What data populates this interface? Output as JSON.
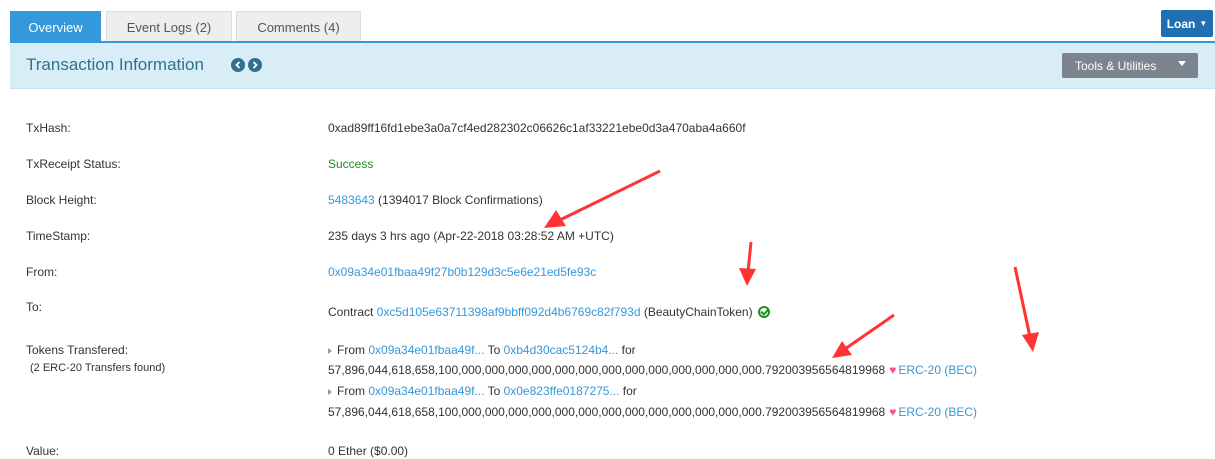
{
  "tabs": [
    {
      "label": "Overview",
      "active": true
    },
    {
      "label": "Event Logs (2)",
      "active": false
    },
    {
      "label": "Comments (4)",
      "active": false
    }
  ],
  "loan_button": "Loan",
  "panel": {
    "title": "Transaction Information",
    "tools_label": "Tools & Utilities"
  },
  "rows": {
    "txhash": {
      "label": "TxHash:",
      "value": "0xad89ff16fd1ebe3a0a7cf4ed282302c06626c1af33221ebe0d3a470aba4a660f"
    },
    "status": {
      "label": "TxReceipt Status:",
      "value": "Success"
    },
    "block": {
      "label": "Block Height:",
      "value": "5483643",
      "confirmations": " (1394017 Block Confirmations)"
    },
    "timestamp": {
      "label": "TimeStamp:",
      "value": "235 days 3 hrs ago (Apr-22-2018 03:28:52 AM +UTC)"
    },
    "from": {
      "label": "From:",
      "value": "0x09a34e01fbaa49f27b0b129d3c5e6e21ed5fe93c"
    },
    "to": {
      "label": "To:",
      "prefix": "Contract ",
      "address": "0xc5d105e63711398af9bbff092d4b6769c82f793d",
      "name": " (BeautyChainToken)"
    },
    "tokens": {
      "label": "Tokens Transfered:",
      "sublabel": "(2 ERC-20 Transfers found)",
      "transfers": [
        {
          "from_word": "From ",
          "from": "0x09a34e01fbaa49f...",
          "to_word": " To ",
          "to": "0xb4d30cac5124b4...",
          "for_word": " for",
          "amount": "57,896,044,618,658,100,000,000,000,000,000,000,000,000,000,000,000,000,000.792003956564819968",
          "token": "ERC-20 (BEC)"
        },
        {
          "from_word": "From ",
          "from": "0x09a34e01fbaa49f...",
          "to_word": " To ",
          "to": "0x0e823ffe0187275...",
          "for_word": " for",
          "amount": "57,896,044,618,658,100,000,000,000,000,000,000,000,000,000,000,000,000,000.792003956564819968",
          "token": "ERC-20 (BEC)"
        }
      ]
    },
    "value": {
      "label": "Value:",
      "value": "0 Ether ($0.00)"
    }
  },
  "colors": {
    "accent": "#3498db",
    "heading_bg": "#d9edf7",
    "success": "#1e8e1e",
    "annotation": "#ff3333"
  }
}
